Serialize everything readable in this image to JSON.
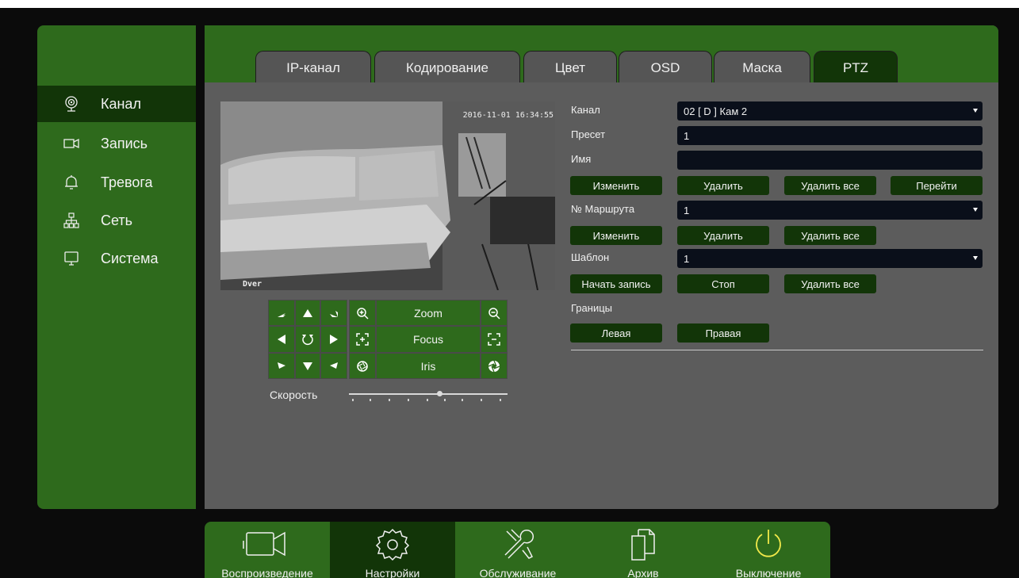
{
  "colors": {
    "accent_green": "#2e6a1c",
    "active_dark_green": "#123508",
    "panel_gray": "#5c5c5c",
    "field_dark": "#0a0f1a"
  },
  "sidebar": {
    "items": [
      {
        "label": "Канал",
        "icon": "webcam-icon",
        "active": true
      },
      {
        "label": "Запись",
        "icon": "video-camera-icon",
        "active": false
      },
      {
        "label": "Тревога",
        "icon": "bell-icon",
        "active": false
      },
      {
        "label": "Сеть",
        "icon": "network-icon",
        "active": false
      },
      {
        "label": "Система",
        "icon": "monitor-icon",
        "active": false
      }
    ]
  },
  "tabs": [
    {
      "label": "IP-канал",
      "active": false
    },
    {
      "label": "Кодирование",
      "active": false
    },
    {
      "label": "Цвет",
      "active": false
    },
    {
      "label": "OSD",
      "active": false
    },
    {
      "label": "Маска",
      "active": false
    },
    {
      "label": "PTZ",
      "active": true
    }
  ],
  "video": {
    "timestamp": "2016-11-01 16:34:55",
    "camera_name": "Dver"
  },
  "ptz": {
    "zoom_label": "Zoom",
    "focus_label": "Focus",
    "iris_label": "Iris",
    "speed_label": "Скорость",
    "speed_level": 0.57
  },
  "form": {
    "channel_label": "Канал",
    "channel_value": "02 [ D ] Кам 2",
    "preset_label": "Пресет",
    "preset_value": "1",
    "name_label": "Имя",
    "name_value": "",
    "preset_buttons": [
      "Изменить",
      "Удалить",
      "Удалить все",
      "Перейти"
    ],
    "route_label": "№ Маршрута",
    "route_value": "1",
    "route_buttons": [
      "Изменить",
      "Удалить",
      "Удалить все"
    ],
    "pattern_label": "Шаблон",
    "pattern_value": "1",
    "pattern_buttons": [
      "Начать запись",
      "Стоп",
      "Удалить все"
    ],
    "bounds_label": "Границы",
    "bounds_buttons": [
      "Левая",
      "Правая"
    ]
  },
  "bottombar": {
    "items": [
      {
        "label": "Воспроизведение",
        "icon": "video-camera-icon",
        "active": false
      },
      {
        "label": "Настройки",
        "icon": "gear-icon",
        "active": true
      },
      {
        "label": "Обслуживание",
        "icon": "tools-icon",
        "active": false
      },
      {
        "label": "Архив",
        "icon": "files-icon",
        "active": false
      },
      {
        "label": "Выключение",
        "icon": "power-icon",
        "active": false
      }
    ]
  }
}
